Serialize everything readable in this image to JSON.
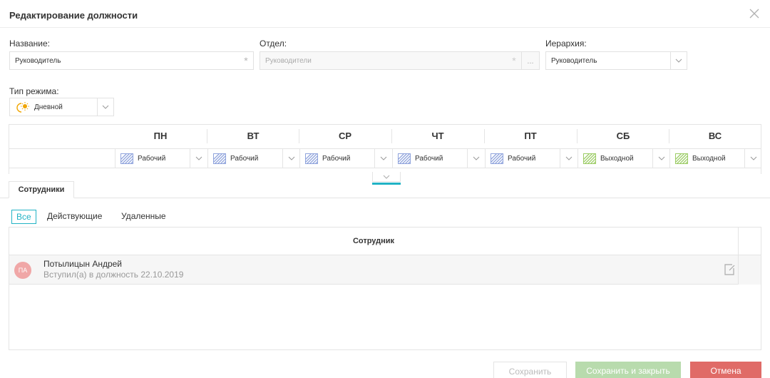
{
  "dialog": {
    "title": "Редактирование должности"
  },
  "form": {
    "name_label": "Название:",
    "name_value": "Руководитель",
    "dept_label": "Отдел:",
    "dept_placeholder": "Руководители",
    "hierarchy_label": "Иерархия:",
    "hierarchy_value": "Руководитель",
    "mode_label": "Тип режима:",
    "mode_value": "Дневной",
    "required_mark": "*",
    "more_mark": "...",
    "mode_icon": "sun-clock-icon"
  },
  "schedule": {
    "days": [
      {
        "name": "ПН",
        "type": "Рабочий",
        "kind": "work"
      },
      {
        "name": "ВТ",
        "type": "Рабочий",
        "kind": "work"
      },
      {
        "name": "СР",
        "type": "Рабочий",
        "kind": "work"
      },
      {
        "name": "ЧТ",
        "type": "Рабочий",
        "kind": "work"
      },
      {
        "name": "ПТ",
        "type": "Рабочий",
        "kind": "work"
      },
      {
        "name": "СБ",
        "type": "Выходной",
        "kind": "off"
      },
      {
        "name": "ВС",
        "type": "Выходной",
        "kind": "off"
      }
    ]
  },
  "tabs": [
    {
      "label": "Сотрудники",
      "active": true
    }
  ],
  "filters": [
    {
      "label": "Все",
      "active": true
    },
    {
      "label": "Действующие",
      "active": false
    },
    {
      "label": "Удаленные",
      "active": false
    }
  ],
  "employees_table": {
    "header": "Сотрудник",
    "rows": [
      {
        "initials": "ПА",
        "name": "Потылицын Андрей",
        "subtitle": "Вступил(а) в должность 22.10.2019"
      }
    ]
  },
  "footer": {
    "save_label": "Сохранить",
    "save_close_label": "Сохранить и закрыть",
    "cancel_label": "Отмена"
  },
  "colors": {
    "accent": "#22b3c5",
    "work": "#8fa3dc",
    "off": "#9ccc65",
    "cancel": "#e06b67",
    "save_close": "#b8dbad"
  }
}
